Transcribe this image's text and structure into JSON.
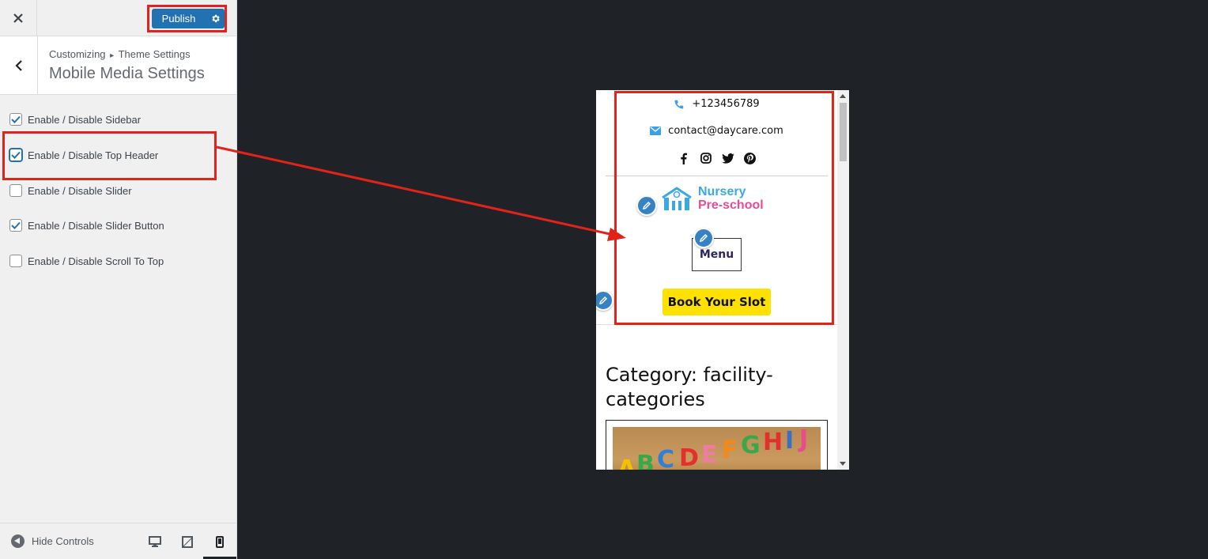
{
  "topbar": {
    "close_icon": "close-icon",
    "publish_label": "Publish",
    "publish_settings_icon": "gear-icon"
  },
  "section": {
    "breadcrumb_root": "Customizing",
    "breadcrumb_separator": "▸",
    "breadcrumb_parent": "Theme Settings",
    "title": "Mobile Media Settings"
  },
  "options": [
    {
      "label": "Enable / Disable Sidebar",
      "checked": true
    },
    {
      "label": "Enable / Disable Top Header",
      "checked": true
    },
    {
      "label": "Enable / Disable Slider",
      "checked": false
    },
    {
      "label": "Enable / Disable Slider Button",
      "checked": true
    },
    {
      "label": "Enable / Disable Scroll To Top",
      "checked": false
    }
  ],
  "footer": {
    "hide_controls_label": "Hide Controls",
    "devices": [
      "desktop",
      "tablet",
      "mobile"
    ],
    "active_device": "mobile"
  },
  "preview": {
    "phone": "+123456789",
    "email": "contact@daycare.com",
    "socials": [
      "facebook",
      "instagram",
      "twitter",
      "pinterest"
    ],
    "logo_line1": "Nursery",
    "logo_line2": "Pre-school",
    "menu_label": "Menu",
    "cta_label": "Book Your Slot",
    "category_title": "Category: facility-categories"
  },
  "colors": {
    "accent": "#2271b1",
    "highlight": "#e2231a",
    "cta": "#ffe100",
    "logo_blue": "#3ba9e0",
    "logo_pink": "#e64c98"
  }
}
